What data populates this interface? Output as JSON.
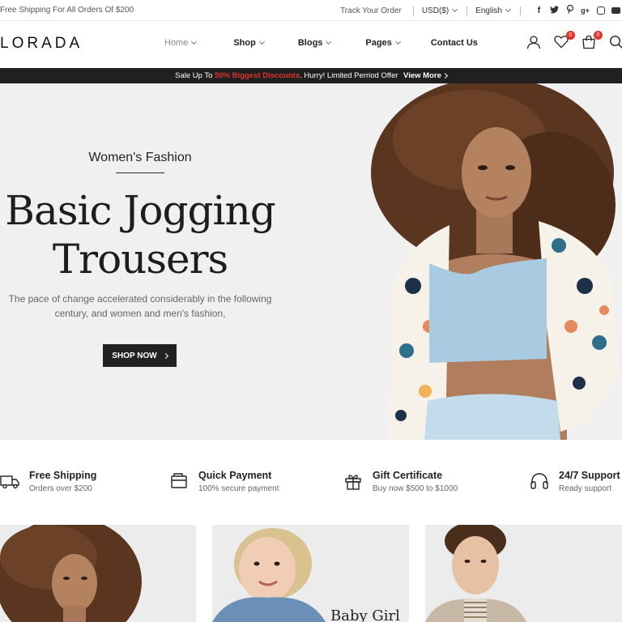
{
  "topbar": {
    "promo": "Free Shipping For All Orders Of $200",
    "track_order": "Track Your Order",
    "currency": "USD($)",
    "language": "English",
    "social": [
      "facebook-icon",
      "twitter-icon",
      "pinterest-icon",
      "google-plus-icon",
      "instagram-icon",
      "youtube-icon"
    ]
  },
  "header": {
    "logo": "LORADA",
    "nav": [
      "Home",
      "Shop",
      "Blogs",
      "Pages",
      "Contact Us"
    ],
    "wishlist_count": "0",
    "cart_count": "0"
  },
  "sale_strip": {
    "prefix": "Sale Up To",
    "highlight": "50% Biggest Discounts",
    "suffix": ". Hurry! Limited Perriod Offer",
    "link": "View More"
  },
  "hero": {
    "subtitle": "Women's Fashion",
    "title_line1": "Basic Jogging",
    "title_line2": "Trousers",
    "desc_line1": "The pace of change accelerated considerably in the following",
    "desc_line2": "century, and women and men's fashion,",
    "cta": "SHOP NOW"
  },
  "features": [
    {
      "title": "Free Shipping",
      "sub": "Orders over $200",
      "icon": "truck-icon"
    },
    {
      "title": "Quick Payment",
      "sub": "100% secure payment",
      "icon": "wallet-icon"
    },
    {
      "title": "Gift Certificate",
      "sub": "Buy now $500 to $1000",
      "icon": "gift-icon"
    },
    {
      "title": "24/7 Support",
      "sub": "Ready support",
      "icon": "headset-icon"
    }
  ],
  "cards": {
    "baby_girl": "Baby Girl"
  },
  "colors": {
    "accent": "#e0322b",
    "dark": "#202020",
    "hero_bg": "#f0f0f0"
  }
}
